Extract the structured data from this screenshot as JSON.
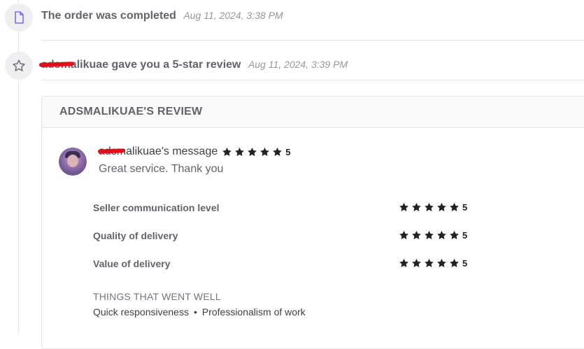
{
  "timeline": {
    "events": [
      {
        "title": "The order was completed",
        "time": "Aug 11, 2024, 3:38 PM",
        "icon": "document-icon"
      },
      {
        "title": "adsmalikuae gave you a 5-star review",
        "time": "Aug 11, 2024, 3:39 PM",
        "icon": "star-outline-icon"
      }
    ]
  },
  "review": {
    "header": "ADSMALIKUAE'S REVIEW",
    "message_author": "adsmalikuae's message",
    "overall_rating": "5",
    "message_text": "Great service. Thank you",
    "ratings": [
      {
        "label": "Seller communication level",
        "value": "5"
      },
      {
        "label": "Quality of delivery",
        "value": "5"
      },
      {
        "label": "Value of delivery",
        "value": "5"
      }
    ],
    "went_well_title": "THINGS THAT WENT WELL",
    "went_well_items": [
      "Quick responsiveness",
      "Professionalism of work"
    ],
    "went_well_separator": "•"
  },
  "colors": {
    "icon_doc": "#7c6fd6",
    "icon_star": "#62646a",
    "star_fill": "#222325",
    "redaction": "#e0101a"
  }
}
